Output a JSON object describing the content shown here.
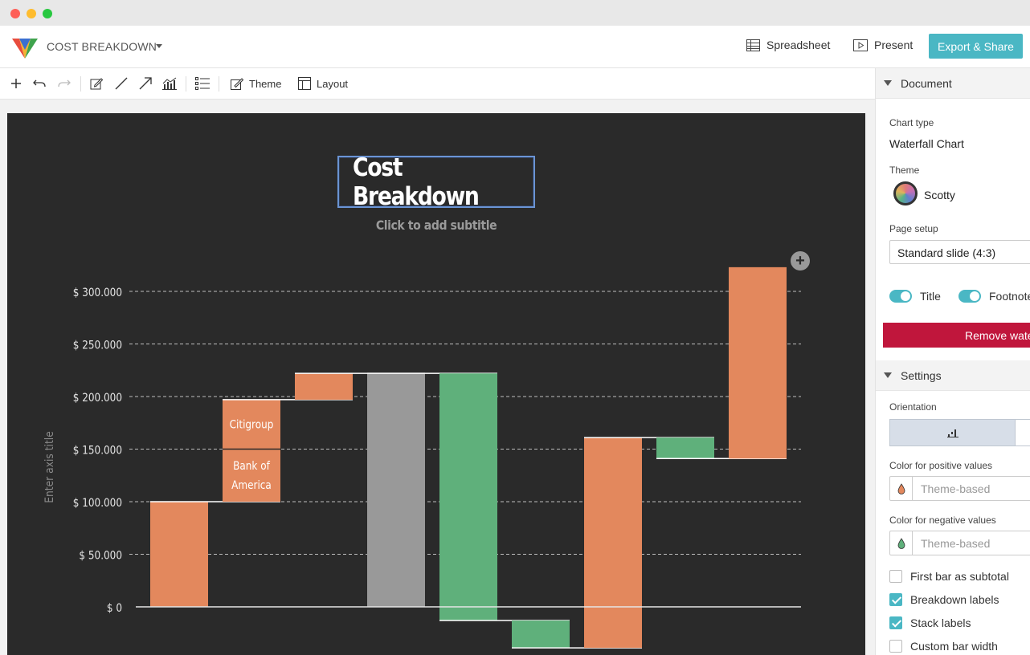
{
  "app": {
    "document_title": "COST BREAKDOWN",
    "spreadsheet_label": "Spreadsheet",
    "present_label": "Present",
    "export_label": "Export & Share",
    "accent_color": "#4ab7c4"
  },
  "toolbar": {
    "icons": [
      "add-icon",
      "undo-icon",
      "redo-icon",
      "edit-icon",
      "line-icon",
      "arrow-icon",
      "chart-icon",
      "list-icon"
    ],
    "theme_label": "Theme",
    "layout_label": "Layout"
  },
  "chart_data": {
    "type": "bar",
    "subtype": "waterfall",
    "title": "Cost Breakdown",
    "subtitle": "Click to add subtitle",
    "ylabel": "Enter axis title",
    "ylim": [
      0,
      300000
    ],
    "y_ticks": [
      "$ 0",
      "$ 50.000",
      "$ 100.000",
      "$ 150.000",
      "$ 200.000",
      "$ 250.000",
      "$ 300.000"
    ],
    "y_tick_values": [
      0,
      50000,
      100000,
      150000,
      200000,
      250000,
      300000
    ],
    "grid": true,
    "bars": [
      {
        "start": 0,
        "end": 100000,
        "kind": "positive"
      },
      {
        "start": 100000,
        "end": 197000,
        "kind": "positive",
        "segments": [
          {
            "start": 100000,
            "end": 150000,
            "label": "Bank of America"
          },
          {
            "start": 150000,
            "end": 197000,
            "label": "Citigroup"
          }
        ]
      },
      {
        "start": 197000,
        "end": 222000,
        "kind": "positive"
      },
      {
        "start": 0,
        "end": 222000,
        "kind": "subtotal"
      },
      {
        "start": 222000,
        "end": -13000,
        "kind": "negative"
      },
      {
        "start": -13000,
        "end": -39000,
        "kind": "negative"
      },
      {
        "start": -39000,
        "end": 161000,
        "kind": "positive"
      },
      {
        "start": 161000,
        "end": 141000,
        "kind": "negative"
      },
      {
        "start": 141000,
        "end": 323000,
        "kind": "positive"
      }
    ],
    "colors": {
      "positive": "#e3885d",
      "negative": "#5fb07b",
      "subtotal": "#999999",
      "background": "#2a2a2a"
    }
  },
  "panel": {
    "document_section": "Document",
    "chart_type_label": "Chart type",
    "chart_type_value": "Waterfall Chart",
    "theme_label": "Theme",
    "theme_value": "Scotty",
    "page_setup_label": "Page setup",
    "page_setup_value": "Standard slide (4:3)",
    "title_toggle": "Title",
    "footnote_toggle": "Footnote",
    "remove_button": "Remove wate",
    "settings_section": "Settings",
    "orientation_label": "Orientation",
    "positive_color_label": "Color for positive values",
    "positive_color_placeholder": "Theme-based",
    "negative_color_label": "Color for negative values",
    "negative_color_placeholder": "Theme-based",
    "checkboxes": [
      {
        "label": "First bar as subtotal",
        "checked": false
      },
      {
        "label": "Breakdown labels",
        "checked": true
      },
      {
        "label": "Stack labels",
        "checked": true
      },
      {
        "label": "Custom bar width",
        "checked": false
      }
    ]
  }
}
